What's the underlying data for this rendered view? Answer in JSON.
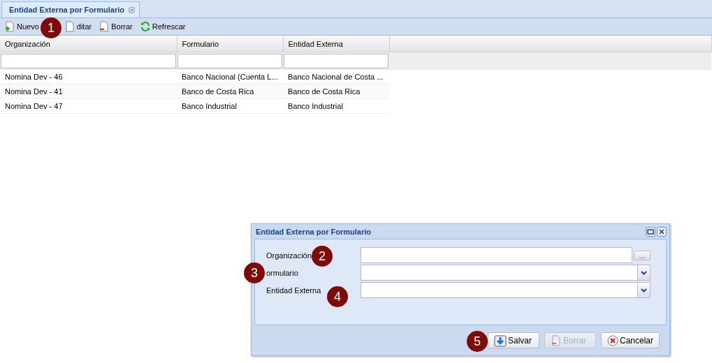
{
  "tab": {
    "title": "Entidad Externa por Formulario",
    "selected": true
  },
  "toolbar": [
    {
      "label": "Nuevo",
      "kind": "new"
    },
    {
      "label": "ditar",
      "kind": "edit"
    },
    {
      "label": "Borrar",
      "kind": "delete"
    },
    {
      "label": "Refrescar",
      "kind": "refresh"
    }
  ],
  "table": {
    "columns": [
      "Organización",
      "Formulario",
      "Entidad Externa"
    ],
    "rows": [
      [
        "Nomina Dev - 46",
        "Banco Nacional (Cuenta L...",
        "Banco Nacional de Costa ..."
      ],
      [
        "Nomina Dev - 41",
        "Banco de Costa Rica",
        "Banco de Costa Rica"
      ],
      [
        "Nomina Dev - 47",
        "Banco Industrial",
        "Banco Industrial"
      ]
    ]
  },
  "dialog": {
    "title": "Entidad Externa por Formulario",
    "fields": [
      {
        "label": "Organización",
        "kind": "picker",
        "button": "..."
      },
      {
        "label": "ormulario",
        "kind": "combo"
      },
      {
        "label": "Entidad Externa",
        "kind": "combo"
      }
    ],
    "buttons": [
      {
        "label": "Salvar",
        "kind": "save",
        "disabled": false
      },
      {
        "label": "Borrar",
        "kind": "delete",
        "disabled": true
      },
      {
        "label": "Cancelar",
        "kind": "cancel",
        "disabled": false
      }
    ]
  },
  "callouts": [
    "1",
    "2",
    "3",
    "4",
    "5"
  ]
}
